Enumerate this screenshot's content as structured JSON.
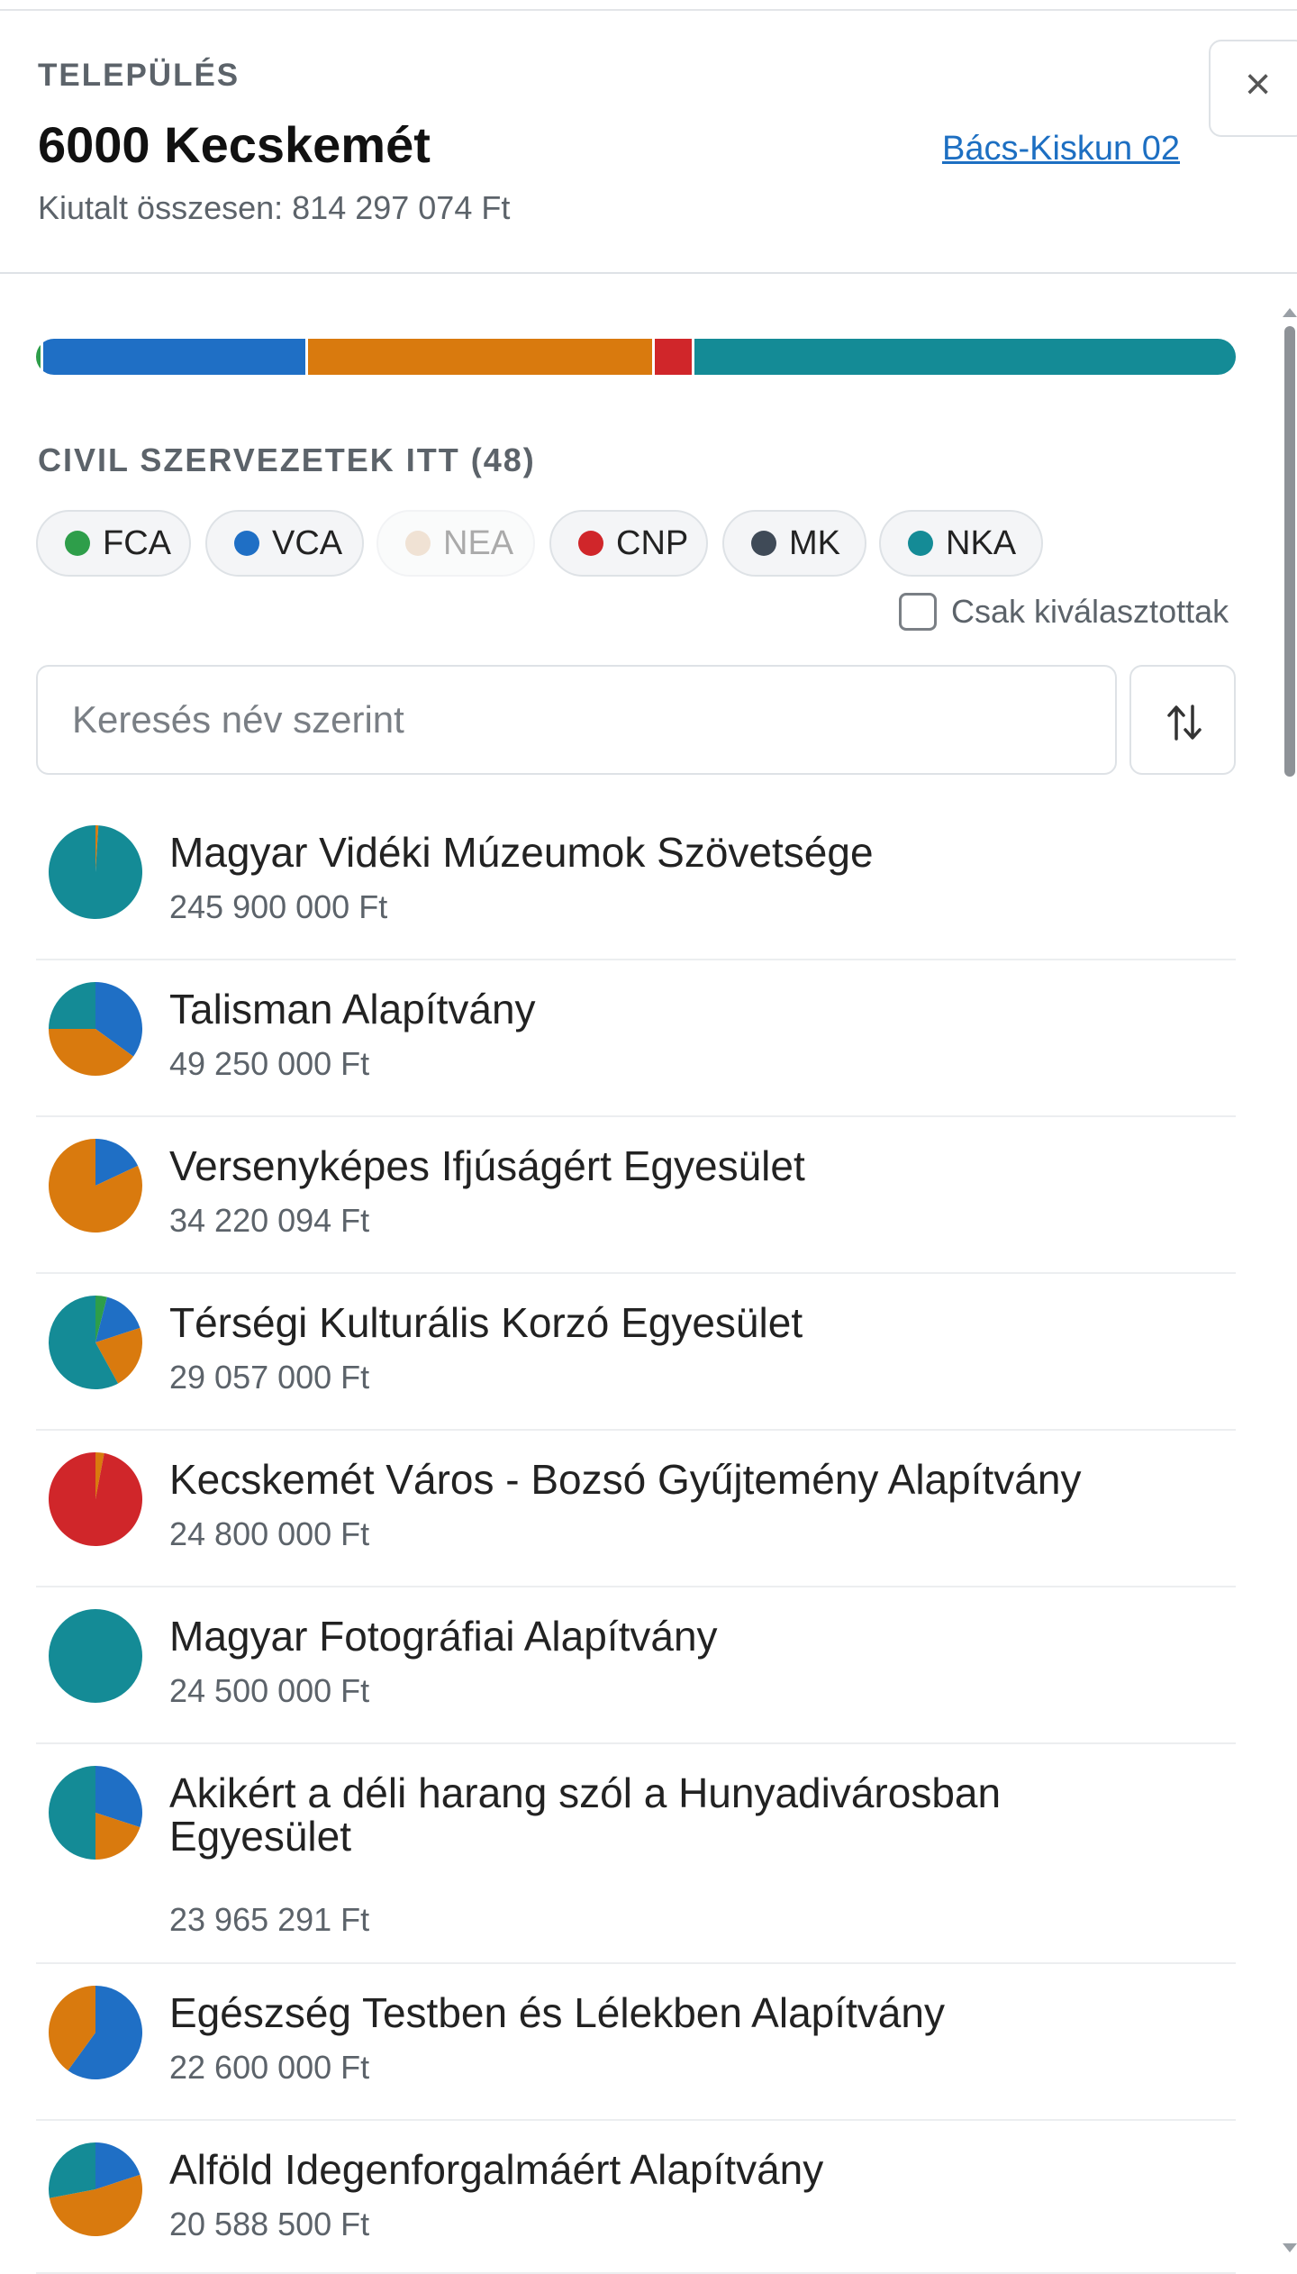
{
  "header": {
    "eyebrow": "TELEPÜLÉS",
    "title": "6000 Kecskemét",
    "region_link": "Bács-Kiskun 02",
    "total": "Kiutalt összesen: 814 297 074 Ft",
    "close_symbol": "×"
  },
  "colors": {
    "FCA": "#2e9e4a",
    "VCA": "#1f6fc5",
    "NEA": "#d9b48f",
    "CNP": "#d0262a",
    "MK": "#3f4a57",
    "NKA": "#148b96"
  },
  "distribution_bar": [
    {
      "fund": "FCA",
      "share": 0.004
    },
    {
      "fund": "VCA",
      "share": 0.22
    },
    {
      "fund": "NKA_gap",
      "share": 0.0
    },
    {
      "fund": "ORANGE",
      "share": 0.29
    },
    {
      "fund": "CNP",
      "share": 0.031
    },
    {
      "fund": "NKA",
      "share": 0.455
    }
  ],
  "orange": "#d97a0e",
  "section_title": "CIVIL SZERVEZETEK ITT (48)",
  "chips": [
    {
      "label": "FCA",
      "active": true
    },
    {
      "label": "VCA",
      "active": true
    },
    {
      "label": "NEA",
      "active": false
    },
    {
      "label": "CNP",
      "active": true
    },
    {
      "label": "MK",
      "active": true
    },
    {
      "label": "NKA",
      "active": true
    }
  ],
  "only_selected_label": "Csak kiválasztottak",
  "search": {
    "placeholder": "Keresés név szerint",
    "value": ""
  },
  "sort_icon": "sort-arrows-icon",
  "organizations": [
    {
      "name": "Magyar Vidéki Múzeumok Szövetsége",
      "amount": "245 900 000 Ft",
      "slices": [
        {
          "c": "orange",
          "v": 0.01
        },
        {
          "c": "NKA",
          "v": 0.99
        }
      ]
    },
    {
      "name": "Talisman Alapítvány",
      "amount": "49 250 000 Ft",
      "slices": [
        {
          "c": "VCA",
          "v": 0.35
        },
        {
          "c": "orange",
          "v": 0.4
        },
        {
          "c": "NKA",
          "v": 0.25
        }
      ]
    },
    {
      "name": "Versenyképes Ifjúságért Egyesület",
      "amount": "34 220 094 Ft",
      "slices": [
        {
          "c": "VCA",
          "v": 0.18
        },
        {
          "c": "orange",
          "v": 0.82
        }
      ]
    },
    {
      "name": "Térségi Kulturális Korzó Egyesület",
      "amount": "29 057 000 Ft",
      "slices": [
        {
          "c": "FCA",
          "v": 0.04
        },
        {
          "c": "VCA",
          "v": 0.16
        },
        {
          "c": "orange",
          "v": 0.22
        },
        {
          "c": "NKA",
          "v": 0.58
        }
      ]
    },
    {
      "name": "Kecskemét Város - Bozsó Gyűjtemény Alapítvány",
      "amount": "24 800 000 Ft",
      "slices": [
        {
          "c": "orange",
          "v": 0.03
        },
        {
          "c": "CNP",
          "v": 0.97
        }
      ]
    },
    {
      "name": "Magyar Fotográfiai Alapítvány",
      "amount": "24 500 000 Ft",
      "slices": [
        {
          "c": "NKA",
          "v": 1.0
        }
      ]
    },
    {
      "name": "Akikért a déli harang szól a Hunyadivárosban Egyesület",
      "amount": "23 965 291 Ft",
      "slices": [
        {
          "c": "VCA",
          "v": 0.3
        },
        {
          "c": "orange",
          "v": 0.2
        },
        {
          "c": "NKA",
          "v": 0.5
        }
      ]
    },
    {
      "name": "Egészség Testben és Lélekben Alapítvány",
      "amount": "22 600 000 Ft",
      "slices": [
        {
          "c": "VCA",
          "v": 0.6
        },
        {
          "c": "orange",
          "v": 0.4
        }
      ]
    },
    {
      "name": "Alföld Idegenforgalmáért Alapítvány",
      "amount": "20 588 500 Ft",
      "slices": [
        {
          "c": "VCA",
          "v": 0.2
        },
        {
          "c": "orange",
          "v": 0.52
        },
        {
          "c": "NKA",
          "v": 0.28
        }
      ]
    }
  ]
}
